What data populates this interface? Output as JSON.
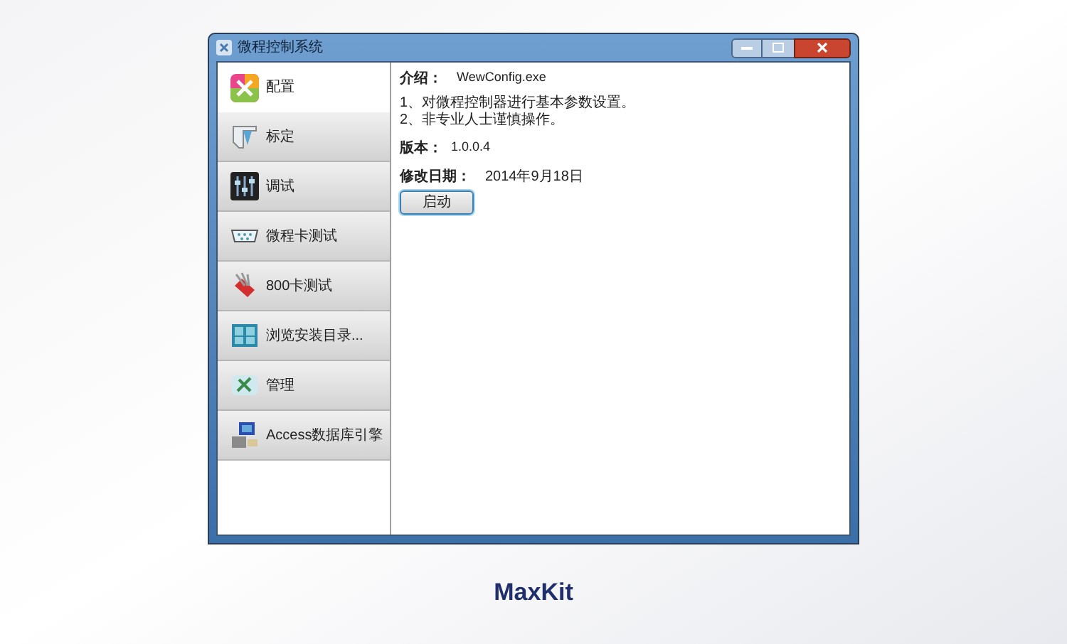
{
  "window": {
    "title": "微程控制系统"
  },
  "sidebar": {
    "items": [
      {
        "label": "配置",
        "selected": true
      },
      {
        "label": "标定",
        "selected": false
      },
      {
        "label": "调试",
        "selected": false
      },
      {
        "label": "微程卡测试",
        "selected": false
      },
      {
        "label": "800卡测试",
        "selected": false
      },
      {
        "label": "浏览安装目录...",
        "selected": false
      },
      {
        "label": "管理",
        "selected": false
      },
      {
        "label": "Access数据库引擎",
        "selected": false
      }
    ]
  },
  "details": {
    "intro_label": "介绍：",
    "intro_value": "WewConfig.exe",
    "notes": [
      "1、对微程控制器进行基本参数设置。",
      "2、非专业人士谨慎操作。"
    ],
    "version_label": "版本：",
    "version_value": "1.0.0.4",
    "date_label": "修改日期：",
    "date_value": "2014年9月18日",
    "start_button": "启动"
  },
  "caption": "MaxKit"
}
